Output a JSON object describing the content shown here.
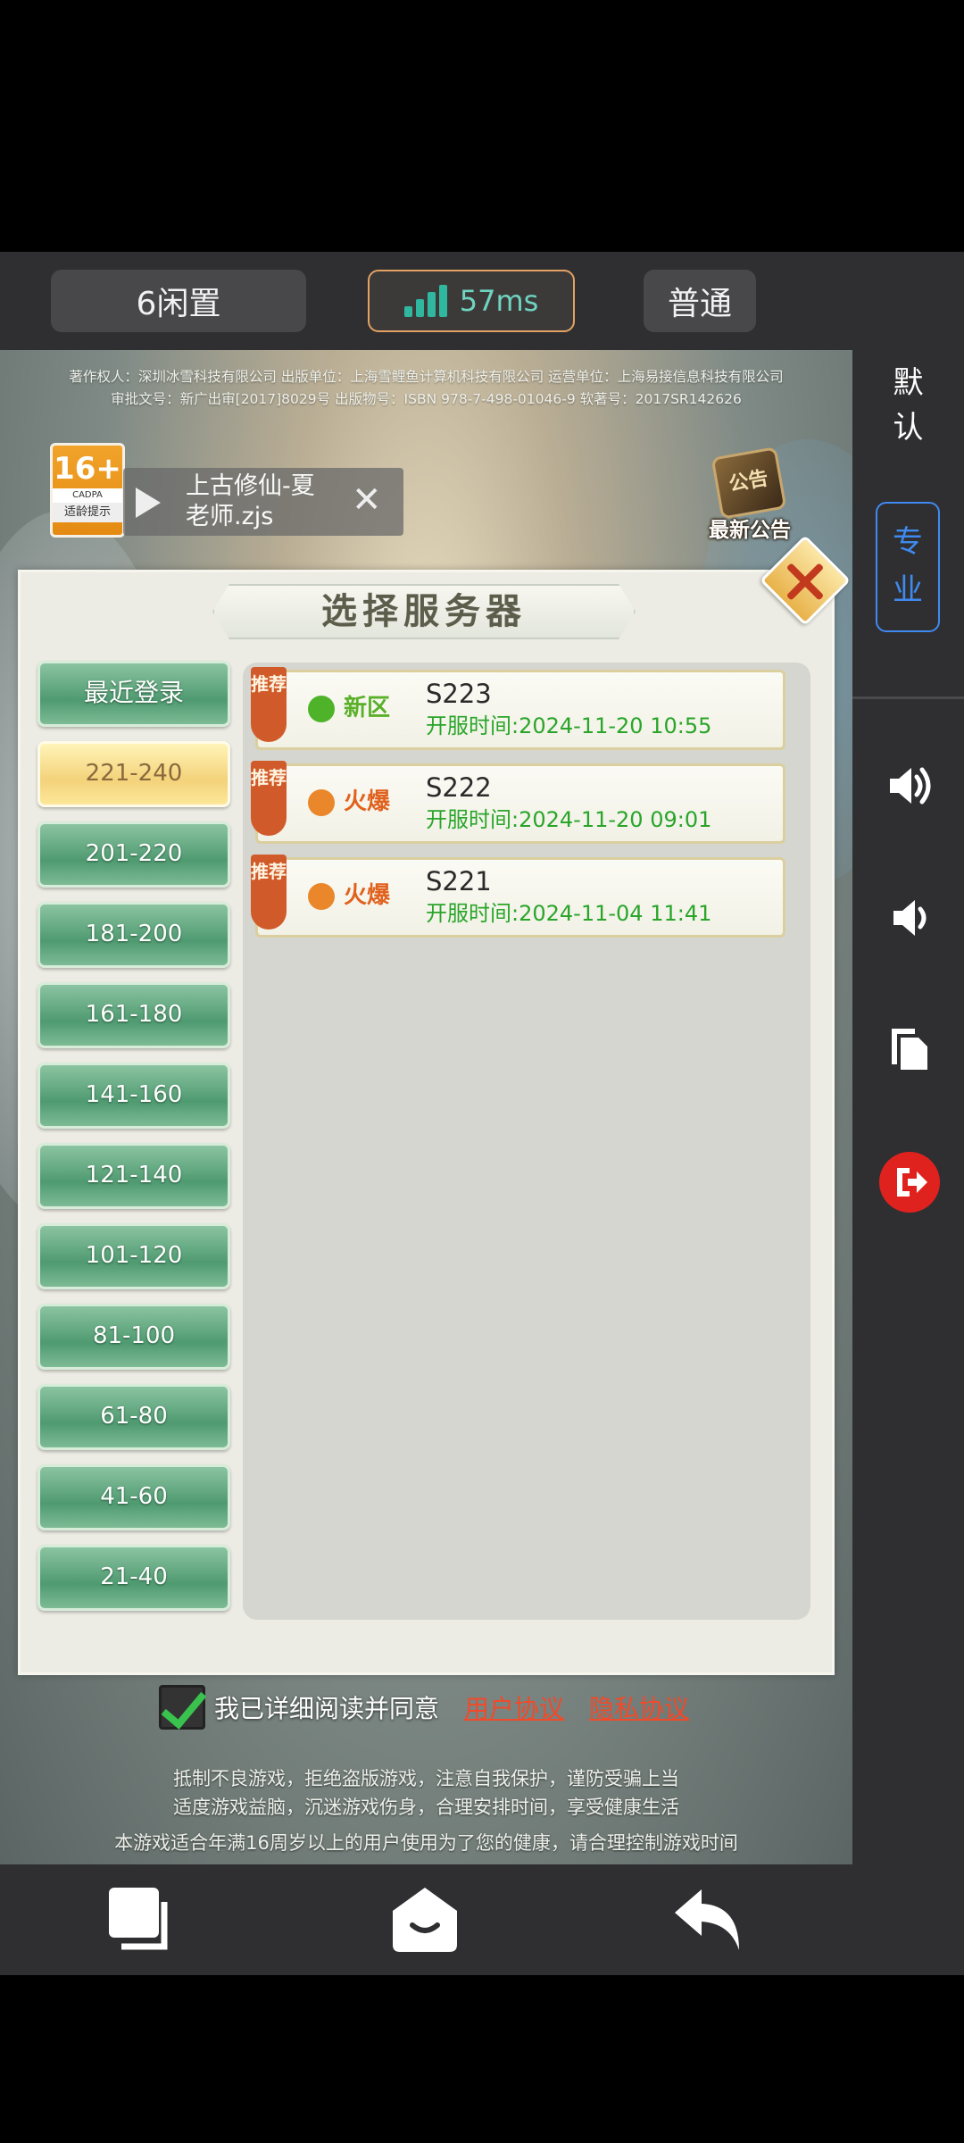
{
  "topbar": {
    "idle_label": "6闲置",
    "ping_label": "57ms",
    "mode_label": "普通"
  },
  "side_panel": {
    "default_label": "默\n认",
    "default_chars": [
      "默",
      "认"
    ],
    "pro_chars": [
      "专",
      "业"
    ],
    "icons": [
      "volume-up-icon",
      "volume-down-icon",
      "copy-icon",
      "exit-icon"
    ]
  },
  "game": {
    "copyright_line1": "著作权人：深圳冰雪科技有限公司  出版单位：上海雪鲤鱼计算机科技有限公司  运营单位：上海易接信息科技有限公司",
    "copyright_line2": "审批文号：新广出审[2017]8029号  出版物号：ISBN 978-7-498-01046-9  软著号：2017SR142626",
    "age_badge": {
      "rating": "16+",
      "org": "CADPA",
      "tip": "适龄提示"
    },
    "video": {
      "title": "上古修仙-夏老师.zjs"
    },
    "notice_label": "最新公告",
    "notice_scroll_text": "公告",
    "panel_title": "选择服务器",
    "ranges": [
      "最近登录",
      "221-240",
      "201-220",
      "181-200",
      "161-180",
      "141-160",
      "121-140",
      "101-120",
      "81-100",
      "61-80",
      "41-60",
      "21-40"
    ],
    "active_range": "221-240",
    "servers": [
      {
        "tag": "推荐",
        "status": "新区",
        "status_color": "#5bb02a",
        "name": "S223",
        "open_time": "开服时间:2024-11-20 10:55"
      },
      {
        "tag": "推荐",
        "status": "火爆",
        "status_color": "#e0621e",
        "name": "S222",
        "open_time": "开服时间:2024-11-20 09:01"
      },
      {
        "tag": "推荐",
        "status": "火爆",
        "status_color": "#e0621e",
        "name": "S221",
        "open_time": "开服时间:2024-11-04 11:41"
      }
    ],
    "agreement": {
      "text": "我已详细阅读并同意",
      "user_agreement": "用户协议",
      "privacy_agreement": "隐私协议",
      "checked": true
    },
    "health_line1": "抵制不良游戏，拒绝盗版游戏，注意自我保护，谨防受骗上当",
    "health_line2": "适度游戏益脑，沉迷游戏伤身，合理安排时间，享受健康生活",
    "health_line3": "本游戏适合年满16周岁以上的用户使用为了您的健康，请合理控制游戏时间"
  },
  "bottom_nav": [
    "recent-apps-icon",
    "home-icon",
    "back-icon"
  ],
  "colors": {
    "accent_blue": "#3f8af0",
    "ping_green": "#2fb89f",
    "range_green": "#4f9a71",
    "range_active": "#f3d27a",
    "time_green": "#2aa52a",
    "exit_red": "#e0221f"
  }
}
